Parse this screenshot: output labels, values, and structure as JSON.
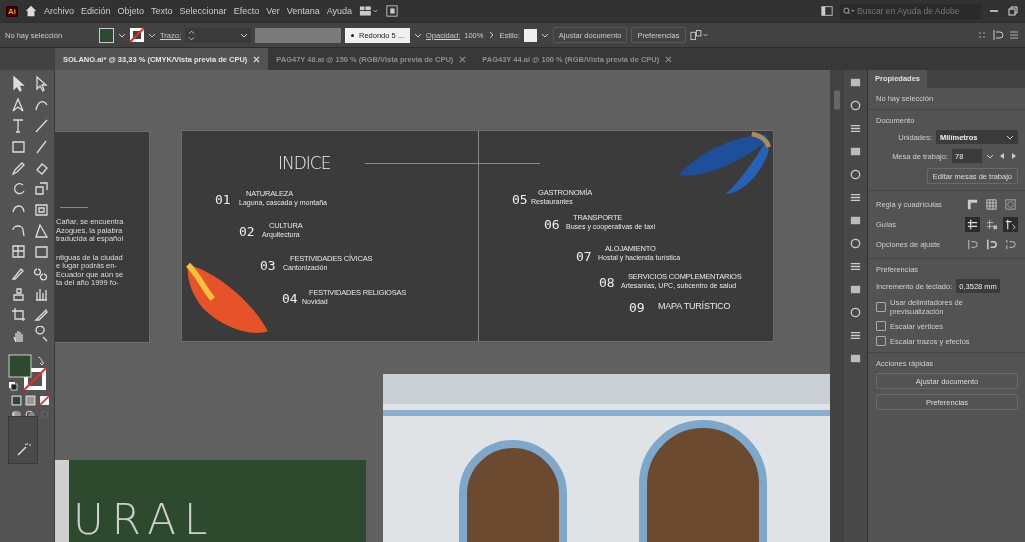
{
  "app": {
    "logo": "Ai",
    "menu": [
      "Archivo",
      "Edición",
      "Objeto",
      "Texto",
      "Seleccionar",
      "Efecto",
      "Ver",
      "Ventana",
      "Ayuda"
    ],
    "search": {
      "placeholder": "Buscar en Ayuda de Adobe"
    }
  },
  "control_bar": {
    "selection": "No hay selección",
    "stroke_label": "Trazo:",
    "brush": "Redondo 5 ...",
    "opacity_label": "Opacidad:",
    "opacity": "100%",
    "style_label": "Estilo:",
    "buttons": [
      "Ajustar documento",
      "Preferencias"
    ]
  },
  "tabs": [
    {
      "label": "SOLANO.ai* @ 33,33 % (CMYK/Vista previa de CPU)",
      "selected": true
    },
    {
      "label": "PAG47Y 48.ai @ 150 % (RGB/Vista previa de CPU)",
      "selected": false
    },
    {
      "label": "PAG43Y 44.ai @ 100 % (RGB/Vista previa de CPU)",
      "selected": false
    }
  ],
  "artboards": {
    "left_text": [
      "Cañar, se encuentra",
      "Azogues, la palabra",
      "traducida al español",
      "ntiguas de la ciudad",
      "e lugar podrás en-",
      "Ecuador que aún se",
      "ta del año 1999 fo-"
    ],
    "index": {
      "title": "INDICE",
      "items": [
        {
          "number": "01",
          "title": "NATURALEZA",
          "subtitle": "Laguna, cascada y montaña"
        },
        {
          "number": "02",
          "title": "CULTURA",
          "subtitle": "Arquitectura"
        },
        {
          "number": "03",
          "title": "FESTIVIDADES CÍVICAS",
          "subtitle": "Cantonización"
        },
        {
          "number": "04",
          "title": "FESTIVIDADES RELIGIOSAS",
          "subtitle": "Novidad"
        },
        {
          "number": "05",
          "title": "GASTRONOMÍA",
          "subtitle": "Restaurantes"
        },
        {
          "number": "06",
          "title": "TRANSPORTE",
          "subtitle": "Buses y cooperativas de taxi"
        },
        {
          "number": "07",
          "title": "ALOJAMIENTO",
          "subtitle": "Hostal y hacienda turística"
        },
        {
          "number": "08",
          "title": "SERVICIOS COMPLEMENTARIOS",
          "subtitle": "Artesanías, UPC, subcentro de salud"
        },
        {
          "number": "09",
          "title": "MAPA TURÍSTICO"
        }
      ]
    },
    "cover_text": "URAL"
  },
  "properties": {
    "tab": "Propiedades",
    "selection": "No hay selección",
    "document": "Documento",
    "units_label": "Unidades:",
    "units": "Milímetros",
    "artboard_label": "Mesa de trabajo:",
    "artboard": "78",
    "edit_button": "Editar mesas de trabajo",
    "rulers": "Regla y cuadrículas",
    "guides": "Guías",
    "snap": "Opciones de ajuste",
    "preferences": "Preferencias",
    "keyboard_label": "Incremento de teclado:",
    "keyboard": "0,3528 mm",
    "checkboxes": [
      {
        "label": "Usar delimitadores de previsualización",
        "checked": false
      },
      {
        "label": "Escalar vértices",
        "checked": false
      },
      {
        "label": "Escalar trazos y efectos",
        "checked": false
      }
    ],
    "quick_actions": "Acciones rápidas",
    "buttons": [
      "Ajustar documento",
      "Preferencias"
    ]
  }
}
